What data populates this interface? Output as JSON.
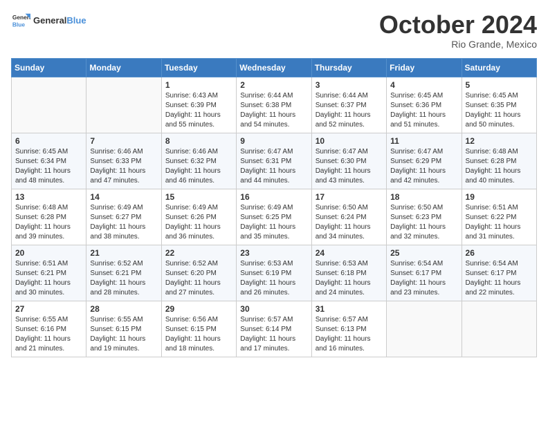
{
  "header": {
    "logo": {
      "line1": "General",
      "line2": "Blue"
    },
    "title": "October 2024",
    "location": "Rio Grande, Mexico"
  },
  "weekdays": [
    "Sunday",
    "Monday",
    "Tuesday",
    "Wednesday",
    "Thursday",
    "Friday",
    "Saturday"
  ],
  "weeks": [
    [
      null,
      null,
      {
        "day": 1,
        "sunrise": "6:43 AM",
        "sunset": "6:39 PM",
        "daylight": "11 hours and 55 minutes."
      },
      {
        "day": 2,
        "sunrise": "6:44 AM",
        "sunset": "6:38 PM",
        "daylight": "11 hours and 54 minutes."
      },
      {
        "day": 3,
        "sunrise": "6:44 AM",
        "sunset": "6:37 PM",
        "daylight": "11 hours and 52 minutes."
      },
      {
        "day": 4,
        "sunrise": "6:45 AM",
        "sunset": "6:36 PM",
        "daylight": "11 hours and 51 minutes."
      },
      {
        "day": 5,
        "sunrise": "6:45 AM",
        "sunset": "6:35 PM",
        "daylight": "11 hours and 50 minutes."
      }
    ],
    [
      {
        "day": 6,
        "sunrise": "6:45 AM",
        "sunset": "6:34 PM",
        "daylight": "11 hours and 48 minutes."
      },
      {
        "day": 7,
        "sunrise": "6:46 AM",
        "sunset": "6:33 PM",
        "daylight": "11 hours and 47 minutes."
      },
      {
        "day": 8,
        "sunrise": "6:46 AM",
        "sunset": "6:32 PM",
        "daylight": "11 hours and 46 minutes."
      },
      {
        "day": 9,
        "sunrise": "6:47 AM",
        "sunset": "6:31 PM",
        "daylight": "11 hours and 44 minutes."
      },
      {
        "day": 10,
        "sunrise": "6:47 AM",
        "sunset": "6:30 PM",
        "daylight": "11 hours and 43 minutes."
      },
      {
        "day": 11,
        "sunrise": "6:47 AM",
        "sunset": "6:29 PM",
        "daylight": "11 hours and 42 minutes."
      },
      {
        "day": 12,
        "sunrise": "6:48 AM",
        "sunset": "6:28 PM",
        "daylight": "11 hours and 40 minutes."
      }
    ],
    [
      {
        "day": 13,
        "sunrise": "6:48 AM",
        "sunset": "6:28 PM",
        "daylight": "11 hours and 39 minutes."
      },
      {
        "day": 14,
        "sunrise": "6:49 AM",
        "sunset": "6:27 PM",
        "daylight": "11 hours and 38 minutes."
      },
      {
        "day": 15,
        "sunrise": "6:49 AM",
        "sunset": "6:26 PM",
        "daylight": "11 hours and 36 minutes."
      },
      {
        "day": 16,
        "sunrise": "6:49 AM",
        "sunset": "6:25 PM",
        "daylight": "11 hours and 35 minutes."
      },
      {
        "day": 17,
        "sunrise": "6:50 AM",
        "sunset": "6:24 PM",
        "daylight": "11 hours and 34 minutes."
      },
      {
        "day": 18,
        "sunrise": "6:50 AM",
        "sunset": "6:23 PM",
        "daylight": "11 hours and 32 minutes."
      },
      {
        "day": 19,
        "sunrise": "6:51 AM",
        "sunset": "6:22 PM",
        "daylight": "11 hours and 31 minutes."
      }
    ],
    [
      {
        "day": 20,
        "sunrise": "6:51 AM",
        "sunset": "6:21 PM",
        "daylight": "11 hours and 30 minutes."
      },
      {
        "day": 21,
        "sunrise": "6:52 AM",
        "sunset": "6:21 PM",
        "daylight": "11 hours and 28 minutes."
      },
      {
        "day": 22,
        "sunrise": "6:52 AM",
        "sunset": "6:20 PM",
        "daylight": "11 hours and 27 minutes."
      },
      {
        "day": 23,
        "sunrise": "6:53 AM",
        "sunset": "6:19 PM",
        "daylight": "11 hours and 26 minutes."
      },
      {
        "day": 24,
        "sunrise": "6:53 AM",
        "sunset": "6:18 PM",
        "daylight": "11 hours and 24 minutes."
      },
      {
        "day": 25,
        "sunrise": "6:54 AM",
        "sunset": "6:17 PM",
        "daylight": "11 hours and 23 minutes."
      },
      {
        "day": 26,
        "sunrise": "6:54 AM",
        "sunset": "6:17 PM",
        "daylight": "11 hours and 22 minutes."
      }
    ],
    [
      {
        "day": 27,
        "sunrise": "6:55 AM",
        "sunset": "6:16 PM",
        "daylight": "11 hours and 21 minutes."
      },
      {
        "day": 28,
        "sunrise": "6:55 AM",
        "sunset": "6:15 PM",
        "daylight": "11 hours and 19 minutes."
      },
      {
        "day": 29,
        "sunrise": "6:56 AM",
        "sunset": "6:15 PM",
        "daylight": "11 hours and 18 minutes."
      },
      {
        "day": 30,
        "sunrise": "6:57 AM",
        "sunset": "6:14 PM",
        "daylight": "11 hours and 17 minutes."
      },
      {
        "day": 31,
        "sunrise": "6:57 AM",
        "sunset": "6:13 PM",
        "daylight": "11 hours and 16 minutes."
      },
      null,
      null
    ]
  ],
  "labels": {
    "sunrise": "Sunrise:",
    "sunset": "Sunset:",
    "daylight": "Daylight:"
  }
}
